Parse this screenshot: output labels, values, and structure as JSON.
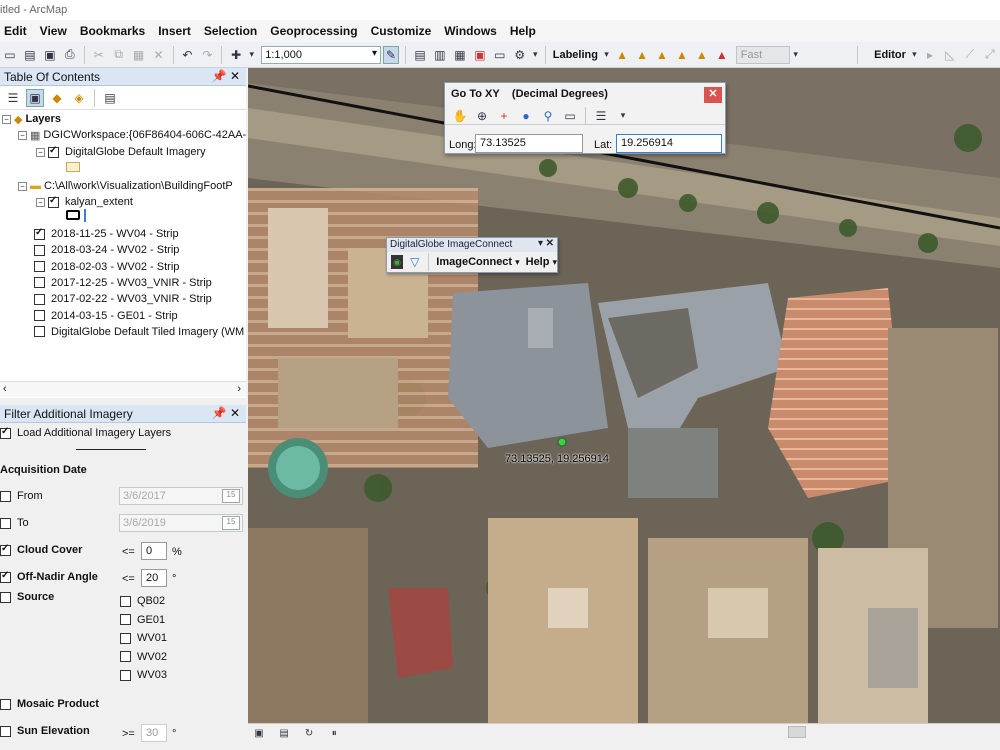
{
  "window": {
    "title": "itled - ArcMap"
  },
  "menu": [
    "Edit",
    "View",
    "Bookmarks",
    "Insert",
    "Selection",
    "Geoprocessing",
    "Customize",
    "Windows",
    "Help"
  ],
  "toolbar": {
    "scale": "1:1,000",
    "labeling": "Labeling",
    "fast": "Fast",
    "editor": "Editor"
  },
  "toc": {
    "title": "Table Of Contents",
    "layers_label": "Layers",
    "workspace": "DGICWorkspace:{06F86404-606C-42AA-",
    "default_imagery": "DigitalGlobe Default Imagery",
    "folder": "C:\\All\\work\\Visualization\\BuildingFootP",
    "kalyan": "kalyan_extent",
    "strips": [
      {
        "label": "2018-11-25 - WV04 - Strip",
        "checked": true
      },
      {
        "label": "2018-03-24 - WV02 - Strip",
        "checked": false
      },
      {
        "label": "2018-02-03 - WV02 - Strip",
        "checked": false
      },
      {
        "label": "2017-12-25 - WV03_VNIR - Strip",
        "checked": false
      },
      {
        "label": "2017-02-22 - WV03_VNIR - Strip",
        "checked": false
      },
      {
        "label": "2014-03-15 - GE01 - Strip",
        "checked": false
      },
      {
        "label": "DigitalGlobe Default Tiled Imagery (WM",
        "checked": false
      }
    ]
  },
  "filter": {
    "title": "Filter Additional Imagery",
    "load": "Load Additional Imagery Layers",
    "acq": "Acquisition Date",
    "from": "From",
    "from_date": "3/6/2017",
    "to": "To",
    "to_date": "3/6/2019",
    "cal": "15",
    "cloud": "Cloud Cover",
    "cloud_op": "<=",
    "cloud_val": "0",
    "cloud_unit": "%",
    "offnadir": "Off-Nadir Angle",
    "offnadir_op": "<=",
    "offnadir_val": "20",
    "offnadir_unit": "°",
    "source": "Source",
    "sources": [
      "QB02",
      "GE01",
      "WV01",
      "WV02",
      "WV03"
    ],
    "mosaic": "Mosaic Product",
    "sun": "Sun Elevation",
    "sun_op": ">=",
    "sun_val": "30",
    "sun_unit": "°"
  },
  "gotoxy": {
    "title": "Go To XY",
    "mode": "(Decimal Degrees)",
    "long_label": "Long:",
    "long": "73.13525",
    "lat_label": "Lat:",
    "lat": "19.256914"
  },
  "imageconnect": {
    "title": "DigitalGlobe ImageConnect",
    "menu1": "ImageConnect",
    "menu2": "Help"
  },
  "map": {
    "point_label": "73.13525, 19.256914"
  },
  "colors": {
    "panel_title": "#dbe6f4",
    "close": "#d9534f",
    "point": "#3fd13f"
  }
}
